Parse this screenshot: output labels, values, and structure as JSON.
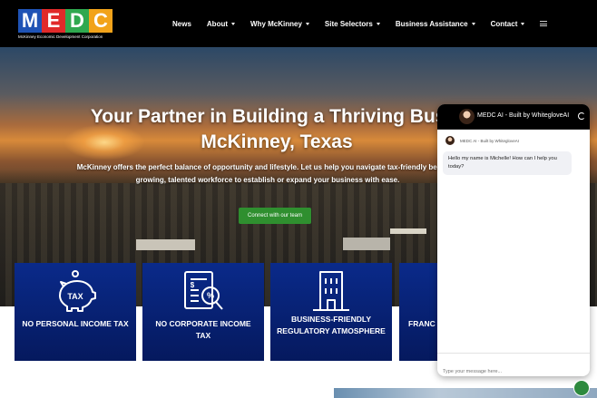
{
  "logo": {
    "letters": [
      "M",
      "E",
      "D",
      "C"
    ],
    "letter_colors": [
      "#1f53b5",
      "#e12a2a",
      "#2fa84f",
      "#f2a31a"
    ],
    "subtitle": "McKinney Economic Development Corporation"
  },
  "nav": {
    "items": [
      {
        "label": "News",
        "dropdown": false
      },
      {
        "label": "About",
        "dropdown": true
      },
      {
        "label": "Why McKinney",
        "dropdown": true
      },
      {
        "label": "Site Selectors",
        "dropdown": true
      },
      {
        "label": "Business Assistance",
        "dropdown": true
      },
      {
        "label": "Contact",
        "dropdown": true
      }
    ],
    "menu_icon": "hamburger-icon"
  },
  "hero": {
    "title_line1": "Your Partner in Building a Thriving Busin",
    "title_line2": "McKinney, Texas",
    "text_line1": "McKinney offers the perfect balance of opportunity and lifestyle. Let us help you navigate tax-friendly benefits,",
    "text_line2": "growing, talented workforce to establish or expand your business with ease.",
    "cta_label": "Connect with our team"
  },
  "cards": [
    {
      "icon": "piggy-bank-tax-icon",
      "label": "NO PERSONAL INCOME TAX"
    },
    {
      "icon": "tax-calculator-icon",
      "label": "NO CORPORATE INCOME TAX"
    },
    {
      "icon": "office-building-icon",
      "label": "BUSINESS-FRIENDLY REGULATORY ATMOSPHERE"
    },
    {
      "icon": "",
      "label": "FRANC"
    }
  ],
  "chat": {
    "title": "MEDC AI - Built by WhitegloveAI",
    "sender": "MEDC AI - Built by WhitegloveAI",
    "message": "Hello my name is Michelle! How can I help you today?",
    "input_placeholder": "Type your message here...",
    "accent": "#000000"
  },
  "colors": {
    "card_blue": "#0a2a8a",
    "cta_green": "#2f8f2f"
  }
}
